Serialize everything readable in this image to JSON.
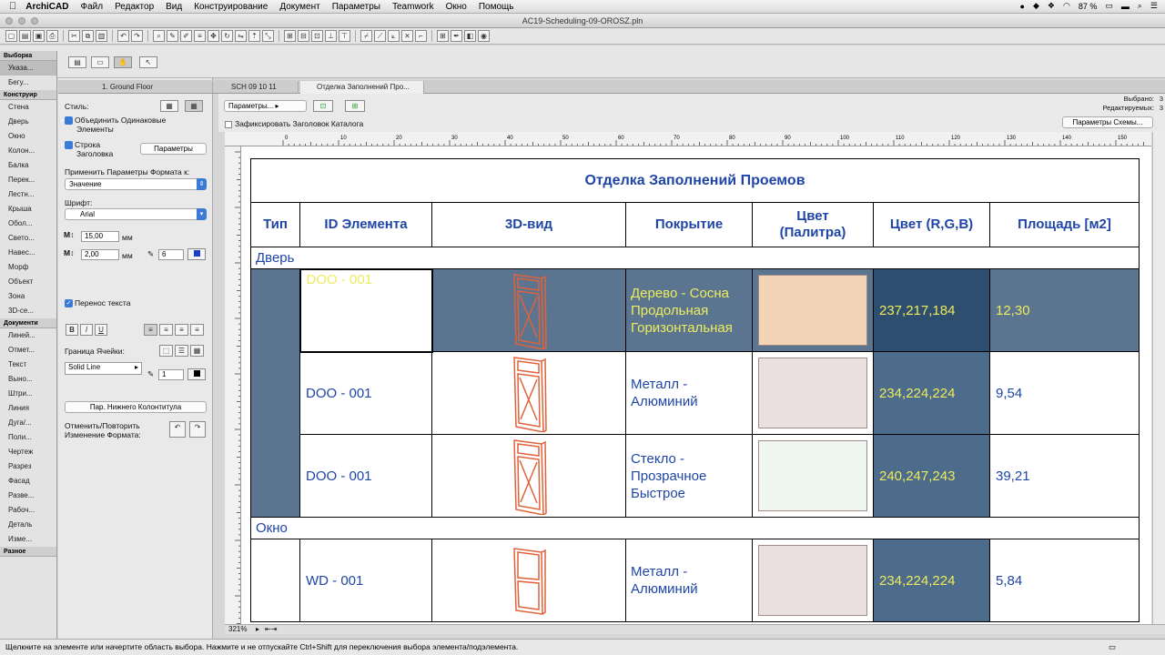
{
  "menubar": {
    "apple": "",
    "app": "ArchiCAD",
    "items": [
      "Файл",
      "Редактор",
      "Вид",
      "Конструирование",
      "Документ",
      "Параметры",
      "Teamwork",
      "Окно",
      "Помощь"
    ],
    "battery": "87 %"
  },
  "window": {
    "title": "AC19-Scheduling-09-OROSZ.pln"
  },
  "toolbox": {
    "sections": [
      {
        "header": "Выборка",
        "items": [
          "Указа...",
          "Бегу..."
        ]
      },
      {
        "header": "Конструир",
        "items": [
          "Стена",
          "Дверь",
          "Окно",
          "Колон...",
          "Балка",
          "Перек...",
          "Лестн...",
          "Крыша",
          "Обол...",
          "Свето...",
          "Навес...",
          "Морф",
          "Объект",
          "Зона",
          "3D-се..."
        ]
      },
      {
        "header": "Документи",
        "items": [
          "Линей...",
          "Отмет...",
          "Текст",
          "Выно...",
          "Штри...",
          "Линия",
          "Дуга/...",
          "Поли...",
          "Чертеж",
          "Разрез",
          "Фасад",
          "Разве...",
          "Рабоч...",
          "Деталь",
          "Изме..."
        ]
      },
      {
        "header": "Разное",
        "items": []
      }
    ]
  },
  "format_panel": {
    "style_label": "Стиль:",
    "merge_label": "Объединить Одинаковые Элементы",
    "header_row_label": "Строка Заголовка",
    "params_button": "Параметры",
    "apply_to_label": "Применить Параметры Формата к:",
    "apply_to_value": "Значение",
    "font_label": "Шрифт:",
    "font_value": "Arial",
    "size1": "15,00",
    "size2": "2,00",
    "unit": "мм",
    "pen": "6",
    "wrap_label": "Перенос текста",
    "bold": "B",
    "italic": "I",
    "underline": "U",
    "border_label": "Граница Ячейки:",
    "line_type": "Solid Line",
    "pen2": "1",
    "footer_button": "Пар. Нижнего Колонтитула",
    "undo_label": "Отменить/Повторить Изменение Формата:"
  },
  "tabs": [
    "1. Ground Floor",
    "SCH 09 10 11",
    "Отделка Заполнений Про..."
  ],
  "canvas_toolbar": {
    "params_button": "Параметры...",
    "freeze_label": "Зафиксировать Заголовок Каталога",
    "selected_label": "Выбрано:",
    "selected_value": "3",
    "editable_label": "Редактируемых:",
    "editable_value": "3",
    "scheme_button": "Параметры Схемы..."
  },
  "ruler_marks": [
    "0",
    "10",
    "20",
    "30",
    "40",
    "50",
    "60",
    "70",
    "80",
    "90",
    "100",
    "110",
    "120",
    "130",
    "140",
    "150",
    "160"
  ],
  "zoom": "321%",
  "schedule": {
    "title": "Отделка Заполнений Проемов",
    "headers": [
      "Тип",
      "ID Элемента",
      "3D-вид",
      "Покрытие",
      "Цвет (Палитра)",
      "Цвет (R,G,B)",
      "Площадь  [м2]"
    ],
    "groups": [
      {
        "name": "Дверь",
        "rows": [
          {
            "id": "DOO - 001",
            "surface": "Дерево - Сосна Продольная Горизонтальная",
            "swatch": "#f4d4b6",
            "rgb": "237,217,184",
            "area": "12,30",
            "selected": true
          },
          {
            "id": "DOO - 001",
            "surface": "Металл - Алюминий",
            "swatch": "#eae0e0",
            "rgb": "234,224,224",
            "area": "9,54",
            "selected": false
          },
          {
            "id": "DOO - 001",
            "surface": "Стекло - Прозрачное Быстрое",
            "swatch": "#f0f7f3",
            "rgb": "240,247,243",
            "area": "39,21",
            "selected": false
          }
        ]
      },
      {
        "name": "Окно",
        "rows": [
          {
            "id": "WD - 001",
            "surface": "Металл - Алюминий",
            "swatch": "#eae0e0",
            "rgb": "234,224,224",
            "area": "5,84",
            "selected": false
          }
        ]
      }
    ]
  },
  "status": "Щелкните на элементе или начертите область выбора. Нажмите и не отпускайте Ctrl+Shift для переключения выбора элемента/подэлемента."
}
